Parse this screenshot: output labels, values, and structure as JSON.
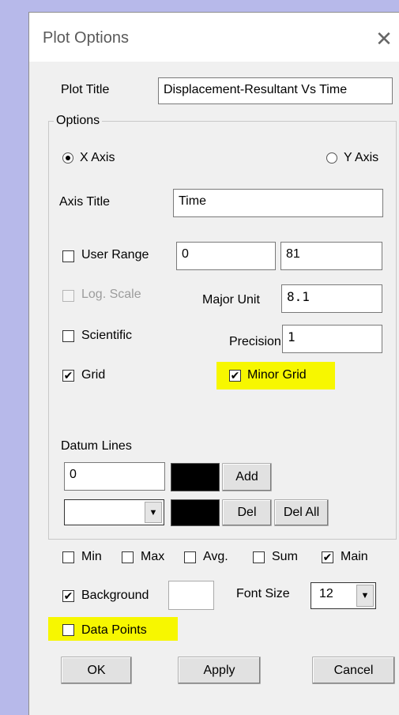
{
  "dialog": {
    "title": "Plot Options",
    "close_glyph": "✕"
  },
  "plot_title": {
    "label": "Plot Title",
    "value": "Displacement-Resultant Vs Time"
  },
  "options": {
    "legend": "Options",
    "x_axis": {
      "label": "X Axis",
      "selected": true
    },
    "y_axis": {
      "label": "Y Axis",
      "selected": false
    },
    "axis_title": {
      "label": "Axis Title",
      "value": "Time"
    },
    "user_range": {
      "label": "User Range",
      "checked": false,
      "min": "0",
      "max": "81"
    },
    "log_scale": {
      "label": "Log. Scale",
      "checked": false,
      "disabled": true
    },
    "major_unit": {
      "label": "Major Unit",
      "value": "8.1"
    },
    "scientific": {
      "label": "Scientific",
      "checked": false
    },
    "precision": {
      "label": "Precision",
      "value": "1"
    },
    "grid": {
      "label": "Grid",
      "checked": true
    },
    "minor_grid": {
      "label": "Minor Grid",
      "checked": true
    },
    "datum_lines": {
      "label": "Datum Lines",
      "value": "0",
      "color": "#000000",
      "add_label": "Add",
      "del_label": "Del",
      "del_all_label": "Del All",
      "select_value": ""
    }
  },
  "stats": {
    "min": {
      "label": "Min",
      "checked": false
    },
    "max": {
      "label": "Max",
      "checked": false
    },
    "avg": {
      "label": "Avg.",
      "checked": false
    },
    "sum": {
      "label": "Sum",
      "checked": false
    },
    "main": {
      "label": "Main",
      "checked": true
    }
  },
  "background": {
    "label": "Background",
    "checked": true,
    "color": "#ffffff"
  },
  "font_size": {
    "label": "Font Size",
    "value": "12"
  },
  "data_points": {
    "label": "Data Points",
    "checked": false
  },
  "buttons": {
    "ok": "OK",
    "apply": "Apply",
    "cancel": "Cancel"
  },
  "check_glyph": "✔",
  "dropdown_glyph": "▼",
  "highlight_color": "#f7f700"
}
